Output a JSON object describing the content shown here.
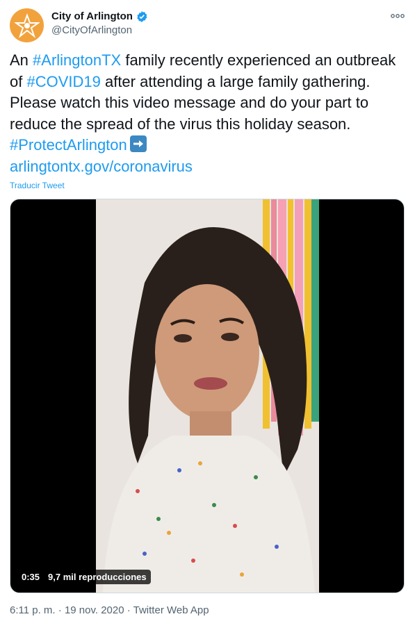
{
  "author": {
    "display_name": "City of Arlington",
    "handle": "@CityOfArlington",
    "avatar_color": "#f2a23c",
    "verified": true
  },
  "tweet": {
    "segments": [
      {
        "text": "An ",
        "link": false
      },
      {
        "text": "#ArlingtonTX",
        "link": true
      },
      {
        "text": " family recently experienced an outbreak of ",
        "link": false
      },
      {
        "text": "#COVID19",
        "link": true
      },
      {
        "text": " after attending a large family gathering. Please watch this video message and do your part to reduce the spread of the virus this holiday season. ",
        "link": false
      },
      {
        "text": "#ProtectArlington",
        "link": true
      }
    ],
    "link_url_text": "arlingtontx.gov/coronavirus",
    "arrow_icon": "right-arrow-emoji"
  },
  "translate_label": "Traducir Tweet",
  "video": {
    "duration": "0:35",
    "views": "9,7 mil reproducciones"
  },
  "meta": {
    "time": "6:11 p. m.",
    "separator": " · ",
    "date": "19 nov. 2020",
    "source": "Twitter Web App"
  },
  "colors": {
    "link": "#1d9bf0",
    "secondary_text": "#536471"
  }
}
